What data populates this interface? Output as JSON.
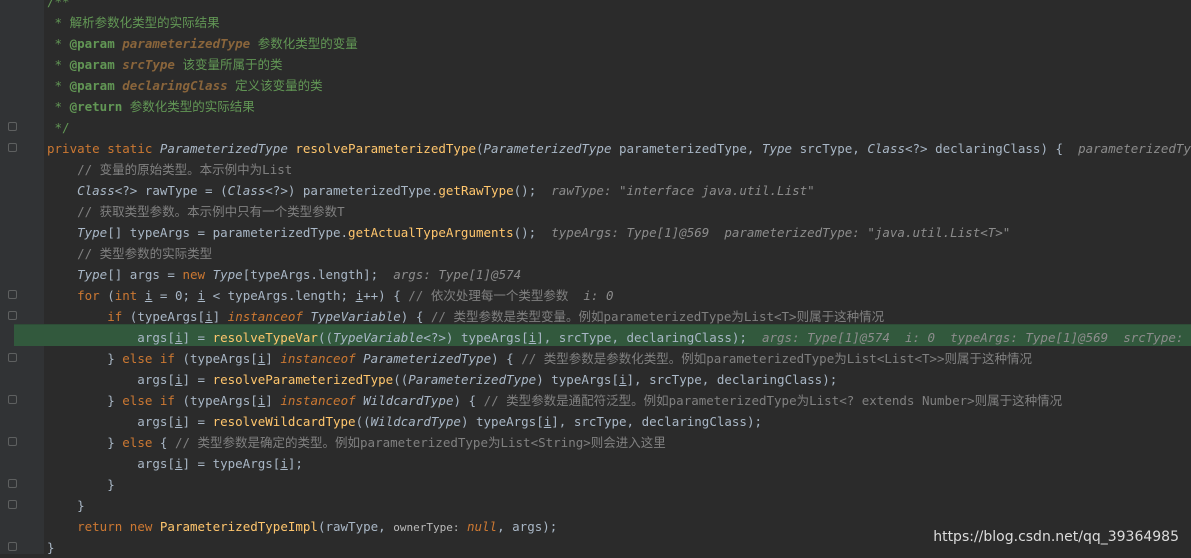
{
  "editor": {
    "lines": [
      {
        "text": "/**"
      },
      {
        "text": " * 解析参数化类型的实际结果"
      },
      {
        "text": " * @param parameterizedType 参数化类型的变量"
      },
      {
        "text": " * @param srcType 该变量所属于的类"
      },
      {
        "text": " * @param declaringClass 定义该变量的类"
      },
      {
        "text": " * @return 参数化类型的实际结果"
      },
      {
        "text": " */"
      },
      {
        "text": "private static ParameterizedType resolveParameterizedType(ParameterizedType parameterizedType, Type srcType, Class<?> declaringClass) {",
        "hint": "parameterizedType: \"java.ut"
      },
      {
        "text": "    // 变量的原始类型。本示例中为List"
      },
      {
        "text": "    Class<?> rawType = (Class<?>) parameterizedType.getRawType();",
        "hint": "rawType: \"interface java.util.List\""
      },
      {
        "text": "    // 获取类型参数。本示例中只有一个类型参数T"
      },
      {
        "text": "    Type[] typeArgs = parameterizedType.getActualTypeArguments();",
        "hint": "typeArgs: Type[1]@569  parameterizedType: \"java.util.List<T>\""
      },
      {
        "text": "    // 类型参数的实际类型"
      },
      {
        "text": "    Type[] args = new Type[typeArgs.length];",
        "hint": "args: Type[1]@574"
      },
      {
        "text": "    for (int i = 0; i < typeArgs.length; i++) { // 依次处理每一个类型参数",
        "hint": "i: 0"
      },
      {
        "text": "        if (typeArgs[i] instanceof TypeVariable) { // 类型参数是类型变量。例如parameterizedType为List<T>则属于这种情况"
      },
      {
        "text": "            args[i] = resolveTypeVar((TypeVariable<?>) typeArgs[i], srcType, declaringClass);",
        "hint": "args: Type[1]@574  i: 0  typeArgs: Type[1]@569  srcType: \"class org.a"
      },
      {
        "text": "        } else if (typeArgs[i] instanceof ParameterizedType) { // 类型参数是参数化类型。例如parameterizedType为List<List<T>>则属于这种情况"
      },
      {
        "text": "            args[i] = resolveParameterizedType((ParameterizedType) typeArgs[i], srcType, declaringClass);"
      },
      {
        "text": "        } else if (typeArgs[i] instanceof WildcardType) { // 类型参数是通配符泛型。例如parameterizedType为List<? extends Number>则属于这种情况"
      },
      {
        "text": "            args[i] = resolveWildcardType((WildcardType) typeArgs[i], srcType, declaringClass);"
      },
      {
        "text": "        } else { // 类型参数是确定的类型。例如parameterizedType为List<String>则会进入这里"
      },
      {
        "text": "            args[i] = typeArgs[i];"
      },
      {
        "text": "        }"
      },
      {
        "text": "    }"
      },
      {
        "text": "    return new ParameterizedTypeImpl(rawType, ownerType: null, args);"
      },
      {
        "text": "}"
      }
    ],
    "param_hint_label": "ownerType:"
  },
  "watermark": "https://blog.csdn.net/qq_39364985",
  "colors": {
    "background": "#2b2b2b",
    "gutter": "#313335",
    "execution_line": "#32593d",
    "keyword": "#cc7832",
    "javadoc": "#629755",
    "comment": "#808080",
    "method": "#ffc66d"
  }
}
